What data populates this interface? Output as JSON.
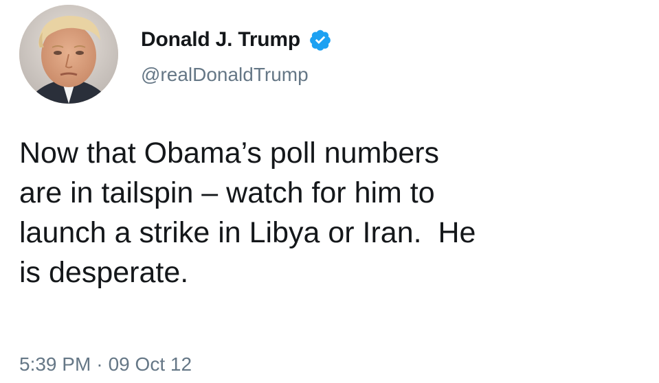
{
  "author": {
    "display_name": "Donald J. Trump",
    "handle": "@realDonaldTrump",
    "verified": true,
    "avatar_icon": "profile-photo"
  },
  "tweet": {
    "lines": [
      "Now that Obama’s poll numbers",
      "are in tailspin – watch for him to",
      "launch a strike in Libya or Iran.  He",
      "is desperate."
    ]
  },
  "meta": {
    "time": "5:39 PM",
    "separator": "·",
    "date": "09 Oct 12"
  },
  "colors": {
    "verified_blue": "#1da1f2",
    "text_primary": "#14171a",
    "text_secondary": "#657786"
  }
}
